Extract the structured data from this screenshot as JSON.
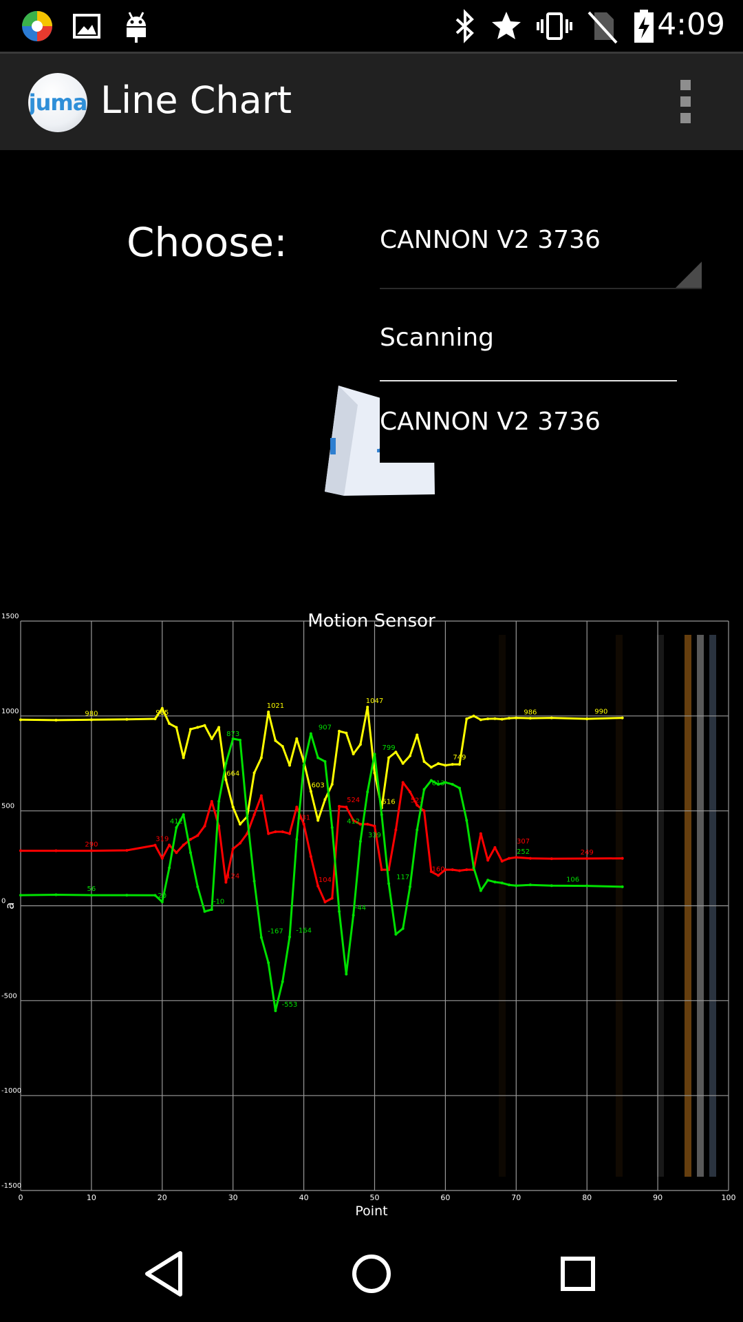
{
  "status_bar": {
    "time": "4:09",
    "icons": [
      "app-launcher-icon",
      "image-icon",
      "android-icon",
      "bluetooth-icon",
      "star-icon",
      "vibrate-icon",
      "no-sim-icon",
      "battery-charging-icon"
    ]
  },
  "action_bar": {
    "logo_text": "juma",
    "title": "Line Chart",
    "menu_icon": "overflow-menu-icon"
  },
  "content": {
    "choose_label": "Choose:",
    "spinner_value": "CANNON V2 3736",
    "dropdown_options": [
      "Scanning",
      "CANNON V2 3736"
    ]
  },
  "chart_data": {
    "type": "line",
    "title": "Motion Sensor",
    "xlabel": "Point",
    "ylabel": "a",
    "xlim": [
      0,
      100
    ],
    "ylim": [
      -1500,
      1500
    ],
    "x_ticks": [
      0,
      10,
      20,
      30,
      40,
      50,
      60,
      70,
      80,
      90,
      100
    ],
    "y_ticks": [
      -1500,
      -1000,
      -500,
      0,
      500,
      1000,
      1500
    ],
    "grid": true,
    "series": [
      {
        "color": "#ffff00",
        "x": [
          0,
          5,
          10,
          15,
          19,
          20,
          21,
          22,
          23,
          24,
          25,
          26,
          27,
          28,
          29,
          30,
          31,
          32,
          33,
          34,
          35,
          36,
          37,
          38,
          39,
          40,
          41,
          42,
          43,
          44,
          45,
          46,
          47,
          48,
          49,
          50,
          51,
          52,
          53,
          54,
          55,
          56,
          57,
          58,
          59,
          60,
          61,
          62,
          63,
          64,
          65,
          66,
          67,
          68,
          69,
          70,
          72,
          75,
          80,
          85
        ],
        "y": [
          980,
          978,
          980,
          982,
          985,
          1040,
          960,
          940,
          780,
          930,
          940,
          950,
          880,
          940,
          664,
          520,
          430,
          470,
          700,
          780,
          1021,
          870,
          840,
          740,
          880,
          760,
          603,
          450,
          560,
          640,
          920,
          910,
          800,
          850,
          1047,
          700,
          516,
          780,
          810,
          750,
          790,
          900,
          760,
          730,
          749,
          740,
          745,
          745,
          985,
          1000,
          980,
          985,
          986,
          983,
          988,
          990,
          988,
          990,
          985,
          990
        ],
        "labels": [
          [
            10,
            980
          ],
          [
            20,
            985
          ],
          [
            30,
            664
          ],
          [
            36,
            1021
          ],
          [
            42,
            603
          ],
          [
            50,
            1047
          ],
          [
            52,
            516
          ],
          [
            62,
            749
          ],
          [
            72,
            986
          ],
          [
            82,
            990
          ]
        ]
      },
      {
        "color": "#ff0000",
        "x": [
          0,
          5,
          10,
          15,
          19,
          20,
          21,
          22,
          23,
          24,
          25,
          26,
          27,
          28,
          29,
          30,
          31,
          32,
          33,
          34,
          35,
          36,
          37,
          38,
          39,
          40,
          41,
          42,
          43,
          44,
          45,
          46,
          47,
          48,
          49,
          50,
          51,
          52,
          53,
          54,
          55,
          56,
          57,
          58,
          59,
          60,
          61,
          62,
          63,
          64,
          65,
          66,
          67,
          68,
          69,
          70,
          72,
          75,
          80,
          85
        ],
        "y": [
          290,
          290,
          290,
          292,
          319,
          250,
          320,
          280,
          320,
          350,
          370,
          420,
          550,
          420,
          124,
          300,
          330,
          380,
          480,
          580,
          380,
          390,
          390,
          380,
          520,
          431,
          260,
          104,
          20,
          40,
          524,
          520,
          450,
          430,
          430,
          420,
          190,
          190,
          400,
          650,
          600,
          530,
          500,
          180,
          160,
          190,
          190,
          185,
          190,
          190,
          380,
          240,
          307,
          235,
          250,
          255,
          250,
          248,
          249,
          250
        ],
        "labels": [
          [
            10,
            290
          ],
          [
            20,
            319
          ],
          [
            30,
            124
          ],
          [
            40,
            431
          ],
          [
            43,
            104
          ],
          [
            47,
            524
          ],
          [
            56,
            523
          ],
          [
            59,
            160
          ],
          [
            71,
            307
          ],
          [
            80,
            249
          ]
        ]
      },
      {
        "color": "#00e000",
        "x": [
          0,
          5,
          10,
          15,
          19,
          20,
          21,
          22,
          23,
          24,
          25,
          26,
          27,
          28,
          29,
          30,
          31,
          32,
          33,
          34,
          35,
          36,
          37,
          38,
          39,
          40,
          41,
          42,
          43,
          44,
          45,
          46,
          47,
          48,
          49,
          50,
          51,
          52,
          53,
          54,
          55,
          56,
          57,
          58,
          59,
          60,
          61,
          62,
          63,
          64,
          65,
          66,
          67,
          68,
          69,
          70,
          72,
          75,
          80,
          85
        ],
        "y": [
          56,
          58,
          56,
          56,
          55,
          20,
          200,
          412,
          480,
          280,
          100,
          -30,
          -20,
          550,
          750,
          880,
          873,
          470,
          130,
          -167,
          -300,
          -553,
          -400,
          -164,
          350,
          740,
          907,
          780,
          760,
          412,
          -30,
          -360,
          -50,
          339,
          600,
          799,
          480,
          117,
          -150,
          -120,
          100,
          400,
          613,
          660,
          640,
          650,
          640,
          620,
          450,
          200,
          80,
          135,
          125,
          120,
          110,
          106,
          110,
          106,
          105,
          100
        ],
        "labels": [
          [
            10,
            56
          ],
          [
            20,
            20
          ],
          [
            22,
            412
          ],
          [
            28,
            -10
          ],
          [
            30,
            873
          ],
          [
            36,
            -167
          ],
          [
            38,
            -553
          ],
          [
            40,
            -164
          ],
          [
            43,
            907
          ],
          [
            47,
            412
          ],
          [
            48,
            -44
          ],
          [
            50,
            339
          ],
          [
            52,
            799
          ],
          [
            54,
            117
          ],
          [
            59,
            613
          ],
          [
            71,
            252
          ],
          [
            78,
            106
          ]
        ]
      }
    ]
  },
  "nav_bar": {
    "icons": [
      "back-icon",
      "home-icon",
      "recents-icon"
    ]
  }
}
